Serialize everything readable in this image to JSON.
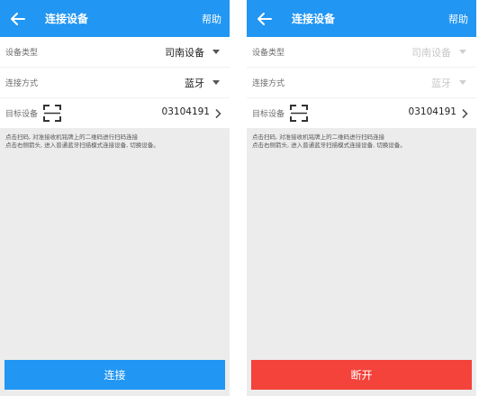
{
  "left": {
    "header": {
      "title": "连接设备",
      "help": "帮助"
    },
    "device_type": {
      "label": "设备类型",
      "value": "司南设备"
    },
    "connection_method": {
      "label": "连接方式",
      "value": "蓝牙"
    },
    "target_device": {
      "label": "目标设备",
      "value": "03104191"
    },
    "hint": {
      "line1": "点击扫码, 对准接收机铭牌上的二维码进行扫码连接",
      "line2": "点击右侧箭头, 进入普通蓝牙扫描模式连接设备, 切换设备。"
    },
    "action_button": "连接"
  },
  "right": {
    "header": {
      "title": "连接设备",
      "help": "帮助"
    },
    "device_type": {
      "label": "设备类型",
      "value": "司南设备"
    },
    "connection_method": {
      "label": "连接方式",
      "value": "蓝牙"
    },
    "target_device": {
      "label": "目标设备",
      "value": "03104191"
    },
    "hint": {
      "line1": "点击扫码, 对准接收机铭牌上的二维码进行扫码连接",
      "line2": "点击右侧箭头, 进入普通蓝牙扫描模式连接设备, 切换设备。"
    },
    "action_button": "断开"
  },
  "colors": {
    "primary": "#2196f3",
    "danger": "#f4433b",
    "background": "#ececec",
    "disabled_text": "#c7c7c7"
  },
  "icons": [
    "back-arrow-icon",
    "dropdown-caret-icon",
    "qr-scan-icon",
    "chevron-right-icon"
  ]
}
